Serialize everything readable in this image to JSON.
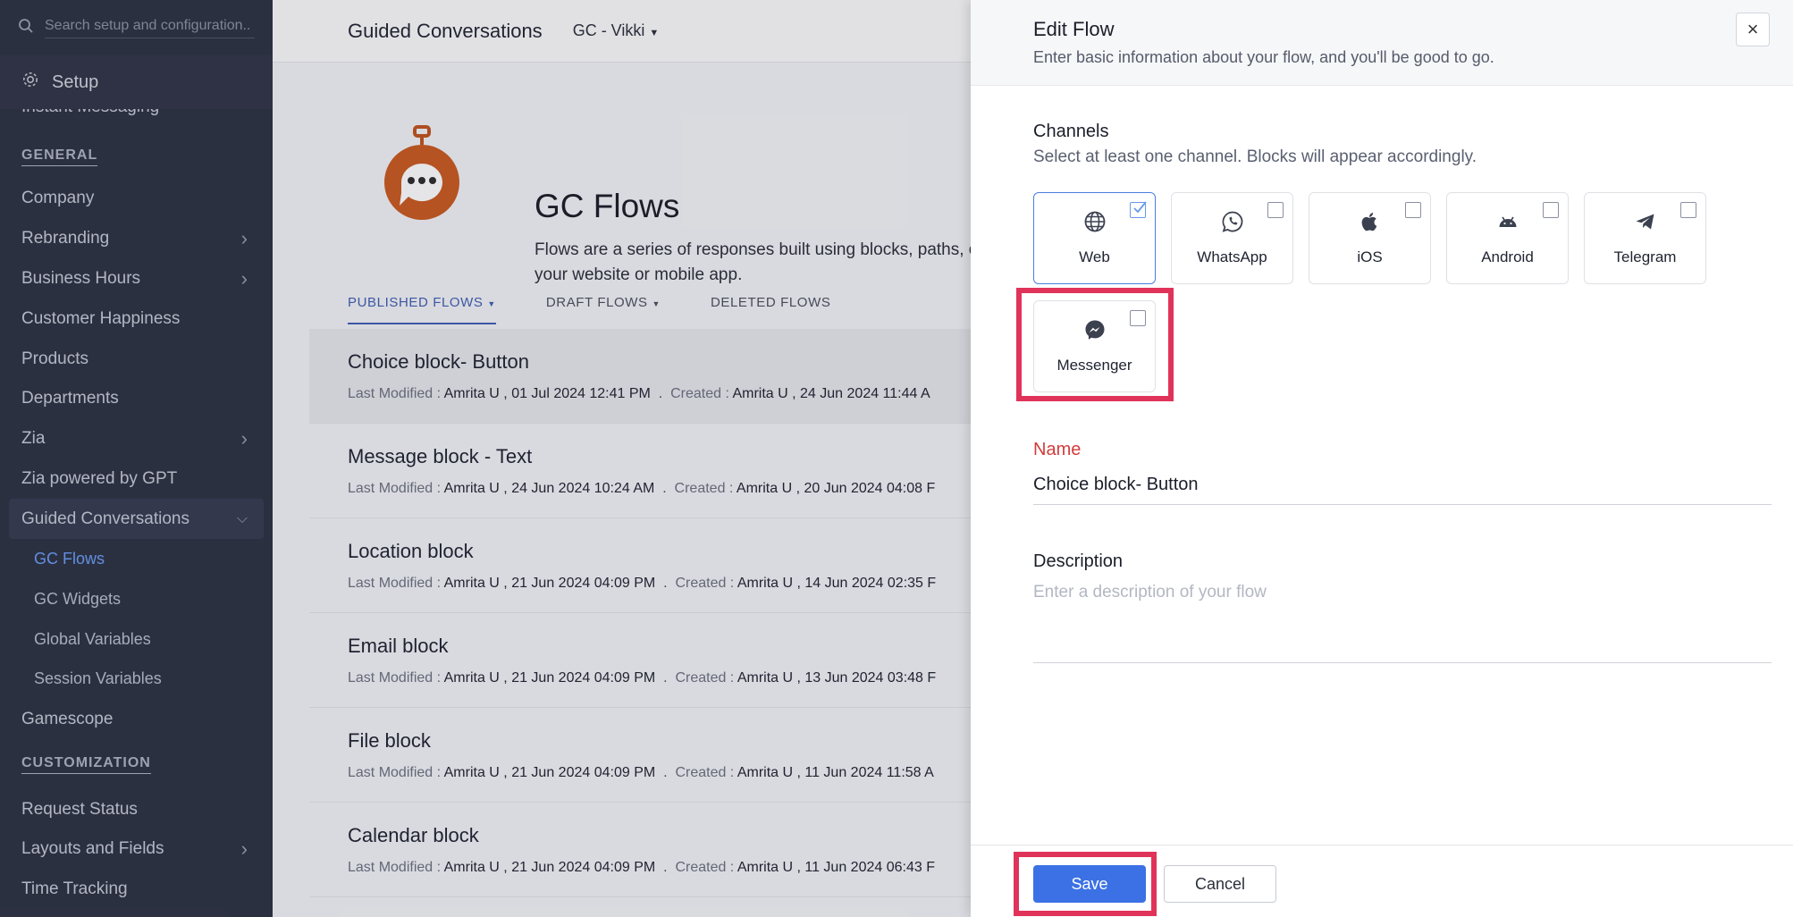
{
  "sidebar": {
    "search_placeholder": "Search setup and configuration..",
    "setup_label": "Setup",
    "cut_item": "Instant Messaging",
    "general_heading": "GENERAL",
    "general_items": [
      {
        "label": "Company"
      },
      {
        "label": "Rebranding"
      },
      {
        "label": "Business Hours"
      },
      {
        "label": "Customer Happiness"
      },
      {
        "label": "Products"
      },
      {
        "label": "Departments"
      },
      {
        "label": "Zia"
      },
      {
        "label": "Zia powered by GPT"
      },
      {
        "label": "Guided Conversations"
      }
    ],
    "gc_sub_items": [
      {
        "label": "GC Flows"
      },
      {
        "label": "GC Widgets"
      },
      {
        "label": "Global Variables"
      },
      {
        "label": "Session Variables"
      }
    ],
    "gamescope": "Gamescope",
    "customization_heading": "CUSTOMIZATION",
    "customization_items": [
      {
        "label": "Request Status"
      },
      {
        "label": "Layouts and Fields"
      },
      {
        "label": "Time Tracking"
      }
    ]
  },
  "main": {
    "topbar_title": "Guided Conversations",
    "department": "GC - Vikki",
    "hero_title": "GC Flows",
    "hero_desc": "Flows are a series of responses built using blocks, paths, on your website or mobile app.",
    "tabs": [
      {
        "label": "PUBLISHED FLOWS"
      },
      {
        "label": "DRAFT FLOWS"
      },
      {
        "label": "DELETED FLOWS"
      }
    ],
    "meta_modified_label": "Last Modified :",
    "meta_created_label": "Created :",
    "flows": [
      {
        "name": "Choice block- Button",
        "modified": "Amrita U , 01 Jul 2024 12:41 PM",
        "created": "Amrita U , 24 Jun 2024 11:44 A"
      },
      {
        "name": "Message block - Text",
        "modified": "Amrita U , 24 Jun 2024 10:24 AM",
        "created": "Amrita U , 20 Jun 2024 04:08 F"
      },
      {
        "name": "Location block",
        "modified": "Amrita U , 21 Jun 2024 04:09 PM",
        "created": "Amrita U , 14 Jun 2024 02:35 F"
      },
      {
        "name": "Email block",
        "modified": "Amrita U , 21 Jun 2024 04:09 PM",
        "created": "Amrita U , 13 Jun 2024 03:48 F"
      },
      {
        "name": "File block",
        "modified": "Amrita U , 21 Jun 2024 04:09 PM",
        "created": "Amrita U , 11 Jun 2024 11:58 A"
      },
      {
        "name": "Calendar block",
        "modified": "Amrita U , 21 Jun 2024 04:09 PM",
        "created": "Amrita U , 11 Jun 2024 06:43 F"
      }
    ]
  },
  "panel": {
    "title": "Edit Flow",
    "subtitle": "Enter basic information about your flow, and you'll be good to go.",
    "channels_label": "Channels",
    "channels_sub": "Select at least one channel. Blocks will appear accordingly.",
    "channels": [
      {
        "label": "Web",
        "icon": "globe-icon",
        "checked": true
      },
      {
        "label": "WhatsApp",
        "icon": "whatsapp-icon",
        "checked": false
      },
      {
        "label": "iOS",
        "icon": "apple-icon",
        "checked": false
      },
      {
        "label": "Android",
        "icon": "android-icon",
        "checked": false
      },
      {
        "label": "Telegram",
        "icon": "telegram-icon",
        "checked": false
      },
      {
        "label": "Messenger",
        "icon": "messenger-icon",
        "checked": false
      }
    ],
    "name_label": "Name",
    "name_value": "Choice block- Button",
    "description_label": "Description",
    "description_placeholder": "Enter a description of your flow",
    "save_label": "Save",
    "cancel_label": "Cancel"
  },
  "colors": {
    "sidebar_bg": "#2c3142",
    "accent": "#3b71e4",
    "highlight": "#e0335a",
    "name_label": "#d23c3c"
  }
}
